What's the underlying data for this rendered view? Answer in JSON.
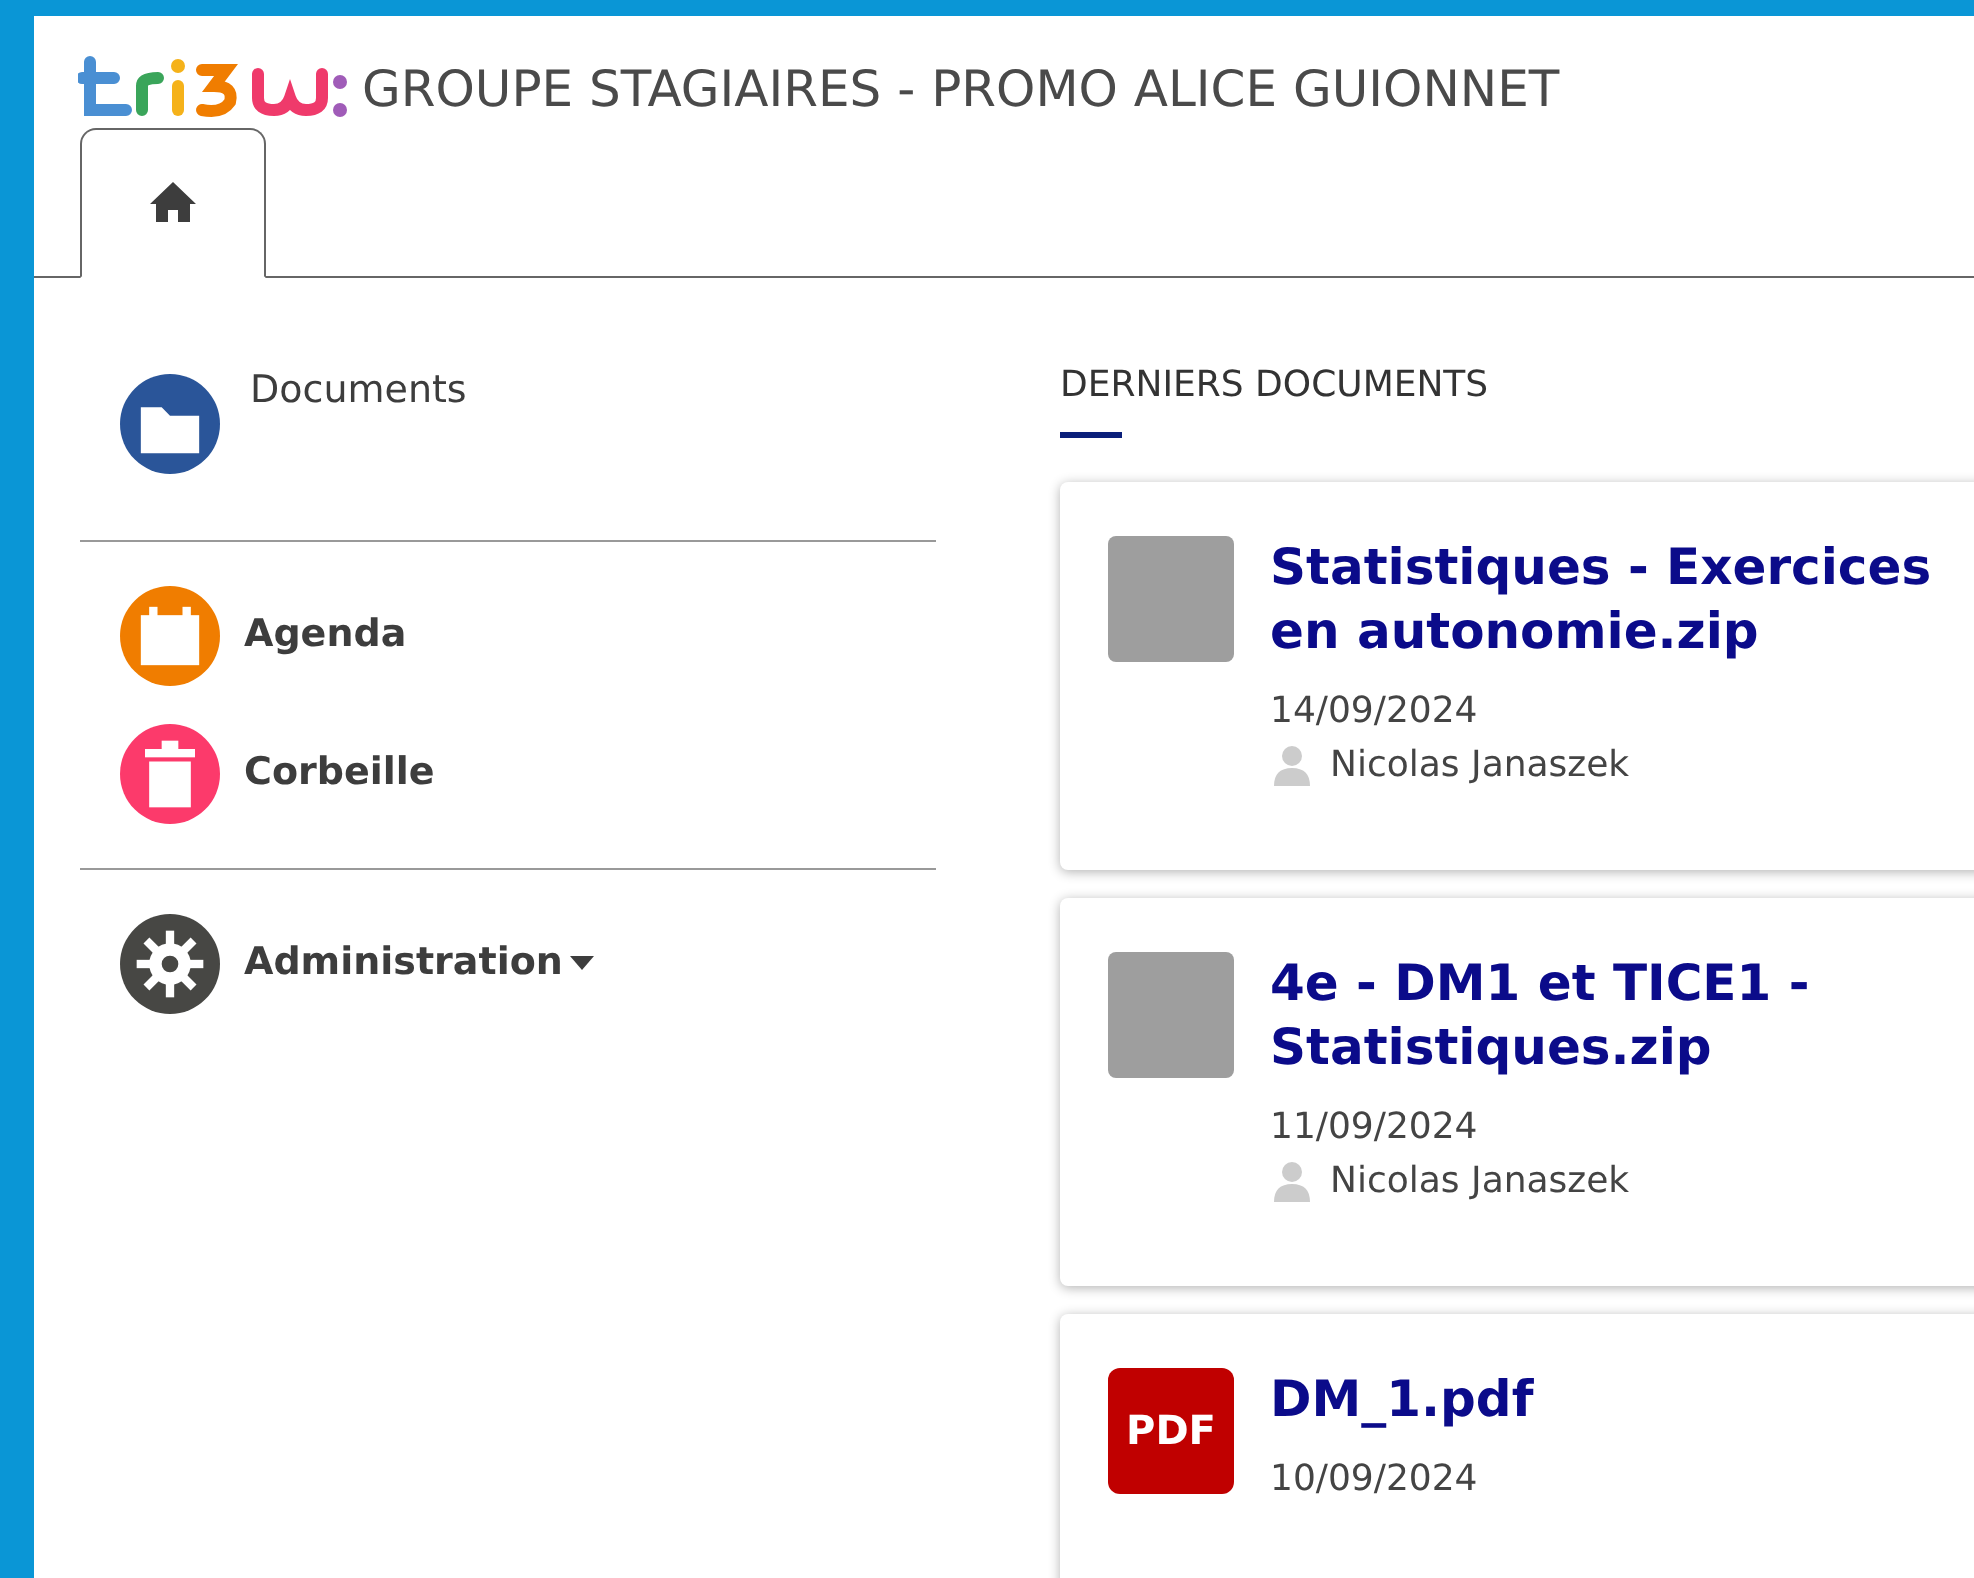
{
  "header": {
    "title": "GROUPE STAGIAIRES - PROMO ALICE GUIONNET"
  },
  "tabs": [
    {
      "kind": "home",
      "selected": true
    }
  ],
  "sidebar": {
    "sections": [
      {
        "items": [
          {
            "label": "Documents",
            "kind": "folder",
            "color": "#2a5599",
            "bold": false,
            "dropdown": false
          }
        ]
      },
      {
        "items": [
          {
            "label": "Agenda",
            "kind": "calendar",
            "color": "#f07d00",
            "bold": true,
            "dropdown": false
          },
          {
            "label": "Corbeille",
            "kind": "trash",
            "color": "#fc3a6b",
            "bold": true,
            "dropdown": false
          }
        ]
      },
      {
        "items": [
          {
            "label": "Administration",
            "kind": "gear",
            "color": "#474744",
            "bold": true,
            "dropdown": true
          }
        ]
      }
    ]
  },
  "latest": {
    "heading": "DERNIERS DOCUMENTS",
    "documents": [
      {
        "name": "Statistiques - Exercices en autonomie.zip",
        "kind": "archive",
        "date": "14/09/2024",
        "author": "Nicolas Janaszek"
      },
      {
        "name": "4e - DM1 et TICE1 - Statistiques.zip",
        "kind": "archive",
        "date": "11/09/2024",
        "author": "Nicolas Janaszek"
      },
      {
        "name": "DM_1.pdf",
        "kind": "pdf",
        "badge": "PDF",
        "date": "10/09/2024"
      }
    ]
  }
}
